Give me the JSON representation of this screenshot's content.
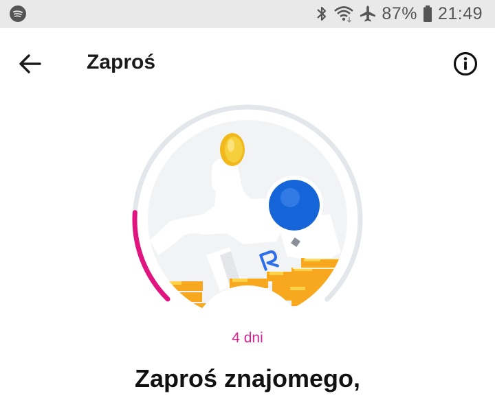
{
  "status_bar": {
    "battery": "87%",
    "time": "21:49",
    "icons": [
      "spotify-icon",
      "bluetooth-icon",
      "wifi-icon",
      "airplane-mode-icon",
      "battery-icon"
    ]
  },
  "toolbar": {
    "title": "Zaproś",
    "icons": [
      "back-arrow-icon",
      "info-icon"
    ]
  },
  "progress": {
    "label": "4 dni",
    "fraction": 0.18,
    "colors": {
      "track": "#e3e6ea",
      "fill": "#e0157f"
    }
  },
  "content": {
    "heading": "Zaproś znajomego,"
  },
  "colors": {
    "accent": "#d6248f",
    "coin": "#f4c430",
    "avatar_blue": "#1565d8",
    "statusbar_bg": "#e9e9e9"
  }
}
